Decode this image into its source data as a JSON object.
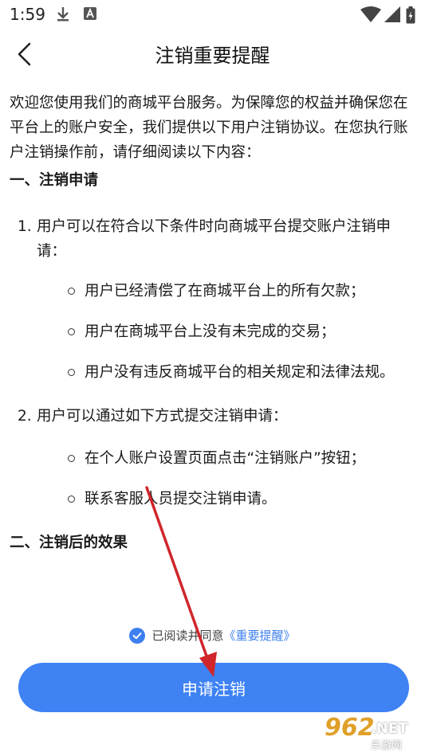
{
  "status_bar": {
    "time": "1:59",
    "icons": [
      "download-icon",
      "a-notification-icon",
      "wifi-icon",
      "signal-icon",
      "battery-icon"
    ]
  },
  "header": {
    "title": "注销重要提醒",
    "back_icon": "chevron-left-icon"
  },
  "content": {
    "intro": "欢迎您使用我们的商城平台服务。为保障您的权益并确保您在平台上的账户安全，我们提供以下用户注销协议。在您执行账户注销操作前，请仔细阅读以下内容：",
    "sections": [
      {
        "title": "一、注销申请",
        "items": [
          {
            "num": "1.",
            "text": "用户可以在符合以下条件时向商城平台提交账户注销申请：",
            "bullets": [
              "用户已经清偿了在商城平台上的所有欠款；",
              "用户在商城平台上没有未完成的交易；",
              "用户没有违反商城平台的相关规定和法律法规。"
            ]
          },
          {
            "num": "2.",
            "text": "用户可以通过如下方式提交注销申请：",
            "bullets": [
              "在个人账户设置页面点击“注销账户”按钮；",
              "联系客服人员提交注销申请。"
            ]
          }
        ]
      },
      {
        "title": "二、注销后的效果"
      }
    ]
  },
  "agreement": {
    "checked": true,
    "label": "已阅读并同意",
    "link": "《重要提醒》"
  },
  "submit_button": {
    "label": "申请注销"
  },
  "colors": {
    "accent": "#3e82f4",
    "annotation_arrow": "#d0262b",
    "watermark": "#e0a02a"
  },
  "watermark": {
    "brand": "962",
    "net": ".NET",
    "sub": "乐游网"
  }
}
